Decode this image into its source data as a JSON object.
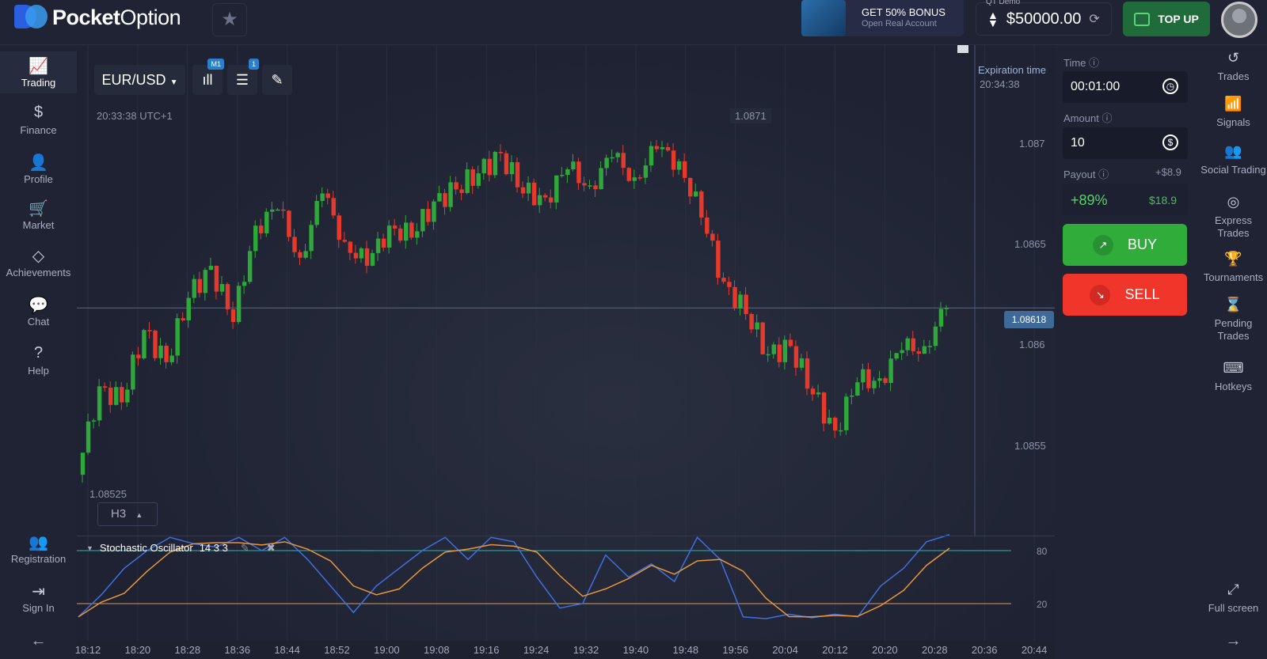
{
  "header": {
    "logo_bold": "Pocket",
    "logo_light": "Option",
    "bonus_title": "GET 50% BONUS",
    "bonus_sub": "Open Real Account",
    "account_label": "QT Demo",
    "balance": "$50000.00",
    "topup": "TOP UP"
  },
  "left_nav": [
    {
      "label": "Trading",
      "icon": "chart-line-icon"
    },
    {
      "label": "Finance",
      "icon": "dollar-icon"
    },
    {
      "label": "Profile",
      "icon": "user-icon"
    },
    {
      "label": "Market",
      "icon": "cart-icon"
    },
    {
      "label": "Achievements",
      "icon": "diamond-icon"
    },
    {
      "label": "Chat",
      "icon": "chat-icon"
    },
    {
      "label": "Help",
      "icon": "help-icon"
    },
    {
      "label": "Registration",
      "icon": "user-plus-icon"
    },
    {
      "label": "Sign In",
      "icon": "sign-in-icon"
    }
  ],
  "right_nav": [
    {
      "label": "Trades",
      "icon": "history-icon"
    },
    {
      "label": "Signals",
      "icon": "antenna-icon"
    },
    {
      "label": "Social Trading",
      "icon": "group-icon"
    },
    {
      "label": "Express Trades",
      "icon": "target-icon"
    },
    {
      "label": "Tournaments",
      "icon": "trophy-icon"
    },
    {
      "label": "Pending Trades",
      "icon": "hourglass-icon"
    },
    {
      "label": "Hotkeys",
      "icon": "keyboard-icon"
    },
    {
      "label": "Full screen",
      "icon": "fullscreen-icon"
    }
  ],
  "panel": {
    "time_label": "Time",
    "time_value": "00:01:00",
    "amount_label": "Amount",
    "amount_value": "10",
    "payout_label": "Payout",
    "payout_profit": "+$8.9",
    "payout_pct": "+89%",
    "payout_total": "$18.9",
    "buy": "BUY",
    "sell": "SELL",
    "buy_color": "#2fac3a",
    "sell_color": "#f0352b"
  },
  "chart": {
    "pair": "EUR/USD",
    "timeframe_badge": "M1",
    "indicator_badge": "1",
    "clock": "20:33:38 UTC+1",
    "expiration_label": "Expiration time",
    "expiration_time": "20:34:38",
    "high_label": "1.0871",
    "low_label": "1.08525",
    "current_price": "1.08618",
    "zoom_label": "H3",
    "price_ticks": [
      "1.087",
      "1.0865",
      "1.086",
      "1.0855"
    ],
    "price_path": [
      1.08535,
      1.08579,
      1.08571,
      1.08607,
      1.08591,
      1.08623,
      1.08639,
      1.08611,
      1.08659,
      1.08667,
      1.08643,
      1.08675,
      1.08651,
      1.08639,
      1.08659,
      1.08653,
      1.08671,
      1.08677,
      1.08685,
      1.08695,
      1.08675,
      1.08673,
      1.08687,
      1.08679,
      1.08693,
      1.08683,
      1.08697,
      1.08691,
      1.08663,
      1.08631,
      1.08615,
      1.08595,
      1.08599,
      1.08575,
      1.08557,
      1.08581,
      1.08583,
      1.08597,
      1.08599,
      1.08618
    ],
    "up_color": "#2fa83a",
    "down_color": "#e6392c"
  },
  "stochastic": {
    "label": "Stochastic Oscillator",
    "params": "14 3 3",
    "levels": [
      "80",
      "20"
    ],
    "k": [
      5,
      30,
      60,
      80,
      95,
      88,
      84,
      95,
      80,
      95,
      70,
      40,
      10,
      40,
      60,
      80,
      95,
      70,
      95,
      90,
      50,
      15,
      20,
      75,
      50,
      65,
      45,
      95,
      70,
      5,
      3,
      8,
      4,
      8,
      5,
      40,
      60,
      90,
      98
    ],
    "k_color": "#3f6fe0",
    "d_color": "#e8963a"
  },
  "time_axis": [
    "18:12",
    "18:20",
    "18:28",
    "18:36",
    "18:44",
    "18:52",
    "19:00",
    "19:08",
    "19:16",
    "19:24",
    "19:32",
    "19:40",
    "19:48",
    "19:56",
    "20:04",
    "20:12",
    "20:20",
    "20:28",
    "20:36",
    "20:44"
  ]
}
